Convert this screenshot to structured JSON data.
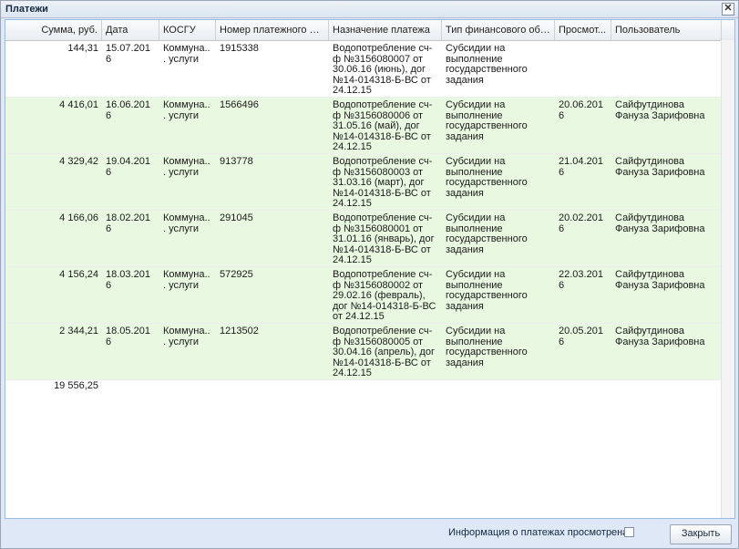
{
  "window": {
    "title": "Платежи",
    "close_glyph": "✕"
  },
  "grid": {
    "columns": [
      "Сумма, руб.",
      "Дата",
      "КОСГУ",
      "Номер платежного по...",
      "Назначение платежа",
      "Тип финансового обе...",
      "Просмот...",
      "Пользователь"
    ],
    "rows": [
      {
        "sum": "144,31",
        "date": "15.07.2016",
        "kosgu": "Коммуна... услуги",
        "number": "1915338",
        "purpose": "Водопотребление сч-ф №3156080007 от 30.06.16 (июнь), дог №14-014318-Б-ВС от 24.12.15",
        "fin_type": "Субсидии на выполнение государственного задания",
        "viewed": "",
        "user": ""
      },
      {
        "sum": "4 416,01",
        "date": "16.06.2016",
        "kosgu": "Коммуна... услуги",
        "number": "1566496",
        "purpose": "Водопотребление сч-ф №3156080006 от 31.05.16 (май), дог №14-014318-Б-ВС от 24.12.15",
        "fin_type": "Субсидии на выполнение государственного задания",
        "viewed": "20.06.2016",
        "user": "Сайфутдинова Фануза Зарифовна"
      },
      {
        "sum": "4 329,42",
        "date": "19.04.2016",
        "kosgu": "Коммуна... услуги",
        "number": "913778",
        "purpose": "Водопотребление сч-ф №3156080003 от 31.03.16 (март), дог №14-014318-Б-ВС от 24.12.15",
        "fin_type": "Субсидии на выполнение государственного задания",
        "viewed": "21.04.2016",
        "user": "Сайфутдинова Фануза Зарифовна"
      },
      {
        "sum": "4 166,06",
        "date": "18.02.2016",
        "kosgu": "Коммуна... услуги",
        "number": "291045",
        "purpose": "Водопотребление сч-ф №3156080001 от 31.01.16 (январь), дог №14-014318-Б-ВС от 24.12.15",
        "fin_type": "Субсидии на выполнение государственного задания",
        "viewed": "20.02.2016",
        "user": "Сайфутдинова Фануза Зарифовна"
      },
      {
        "sum": "4 156,24",
        "date": "18.03.2016",
        "kosgu": "Коммуна... услуги",
        "number": "572925",
        "purpose": "Водопотребление сч-ф №3156080002 от 29.02.16 (февраль), дог №14-014318-Б-ВС от 24.12.15",
        "fin_type": "Субсидии на выполнение государственного задания",
        "viewed": "22.03.2016",
        "user": "Сайфутдинова Фануза Зарифовна"
      },
      {
        "sum": "2 344,21",
        "date": "18.05.2016",
        "kosgu": "Коммуна... услуги",
        "number": "1213502",
        "purpose": "Водопотребление сч-ф №3156080005 от 30.04.16 (апрель), дог №14-014318-Б-ВС от 24.12.15",
        "fin_type": "Субсидии на выполнение государственного задания",
        "viewed": "20.05.2016",
        "user": "Сайфутдинова Фануза Зарифовна"
      }
    ],
    "total": "19 556,25"
  },
  "footer": {
    "viewed_label": "Информация о платежах просмотрена",
    "viewed_checked": false,
    "close_label": "Закрыть"
  },
  "colors": {
    "highlight_row": "#e9f9e1",
    "window_bg": "#dfe8f6"
  }
}
